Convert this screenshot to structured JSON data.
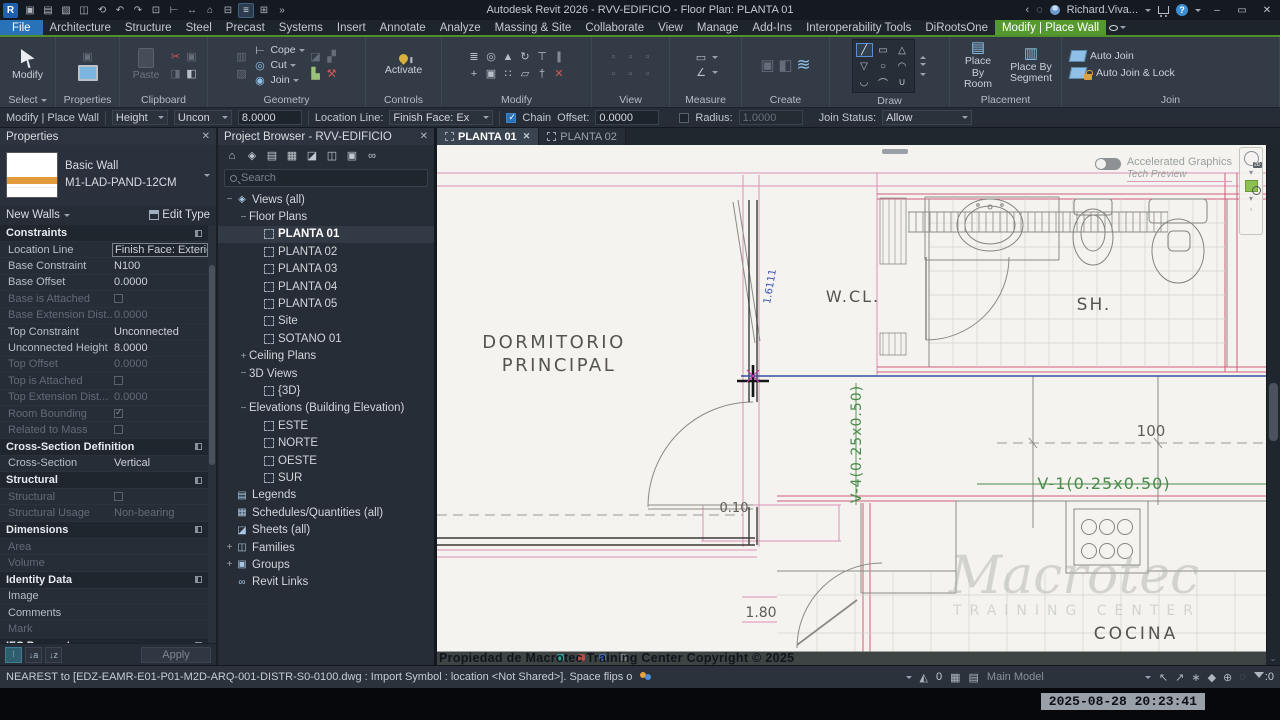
{
  "colors": {
    "contextual_green": "#55982e",
    "file_blue": "#2a72b8",
    "selection_blue": "#3450a0",
    "underlay_pink": "#dd8fb4",
    "underlay_red": "#cf5d78",
    "beam_green": "#4a8a4a",
    "canvas_bg": "#f4f3ef"
  },
  "title_bar": {
    "window_title": "Autodesk Revit 2026 - RVV-EDIFICIO - Floor Plan: PLANTA 01",
    "logo": "R",
    "user": "Richard.Viva...",
    "quick_access_icons": [
      "app-home",
      "new",
      "open",
      "save",
      "sync",
      "undo",
      "redo",
      "print",
      "measure",
      "dimension",
      "home-3d",
      "section",
      "thin-lines",
      "interface",
      "more"
    ],
    "right_icons": [
      "prev-arrow",
      "search",
      "avatar",
      "cart",
      "help"
    ],
    "window_controls": [
      "minimize",
      "restore",
      "close"
    ]
  },
  "ribbon": {
    "tabs": [
      {
        "label": "File",
        "style": "file"
      },
      {
        "label": "Architecture"
      },
      {
        "label": "Structure"
      },
      {
        "label": "Steel"
      },
      {
        "label": "Precast"
      },
      {
        "label": "Systems"
      },
      {
        "label": "Insert"
      },
      {
        "label": "Annotate"
      },
      {
        "label": "Analyze"
      },
      {
        "label": "Massing & Site"
      },
      {
        "label": "Collaborate"
      },
      {
        "label": "View"
      },
      {
        "label": "Manage"
      },
      {
        "label": "Add-Ins"
      },
      {
        "label": "Interoperability Tools"
      },
      {
        "label": "DiRootsOne"
      },
      {
        "label": "Modify | Place Wall",
        "style": "ctx"
      }
    ],
    "panels": {
      "select": {
        "label": "Select",
        "button": "Modify"
      },
      "properties": {
        "label": "Properties"
      },
      "clipboard": {
        "label": "Clipboard",
        "paste": "Paste",
        "icons": [
          "cut",
          "copy",
          "match"
        ]
      },
      "geometry": {
        "label": "Geometry",
        "items": [
          "Cope",
          "Cut",
          "Join"
        ]
      },
      "controls": {
        "label": "Controls",
        "button": "Activate"
      },
      "modify": {
        "label": "Modify",
        "icons": [
          "align",
          "offset",
          "mirror",
          "rotate",
          "trim",
          "split",
          "move",
          "copy",
          "array",
          "scale",
          "pin",
          "delete"
        ]
      },
      "view": {
        "label": "View",
        "icons": [
          "view-icon-1",
          "view-icon-2",
          "view-icon-3",
          "view-icon-4",
          "view-icon-5",
          "view-icon-6"
        ]
      },
      "measure": {
        "label": "Measure",
        "icons": [
          "ruler",
          "angular"
        ]
      },
      "create": {
        "label": "Create",
        "icons": [
          "group",
          "assembly",
          "wall"
        ]
      },
      "draw": {
        "label": "Draw",
        "tools": [
          "line",
          "rectangle",
          "inscribed-polygon",
          "circumscribed-polygon",
          "circle",
          "arc-start-end",
          "arc-center-ends",
          "arc-tangent",
          "arc-fillet"
        ]
      },
      "placement": {
        "label": "Placement",
        "buttons": [
          "Place By\nRoom",
          "Place By\nSegment"
        ]
      },
      "join": {
        "label": "Join",
        "items": [
          "Auto Join",
          "Auto Join & Lock"
        ]
      }
    }
  },
  "options_bar": {
    "mode_label": "Modify | Place Wall",
    "height_dd": "Height",
    "level_dd": "Uncon",
    "height_value": "8.0000",
    "location_line_label": "Location Line:",
    "location_line_value": "Finish Face: Ex",
    "chain_label": "Chain",
    "chain_checked": true,
    "offset_label": "Offset:",
    "offset_value": "0.0000",
    "radius_label": "Radius:",
    "radius_value": "1.0000",
    "radius_checked": false,
    "join_status_label": "Join Status:",
    "join_status_value": "Allow"
  },
  "properties": {
    "header": "Properties",
    "type_family": "Basic Wall",
    "type_name": "M1-LAD-PAND-12CM",
    "selector": "New Walls",
    "edit_type": "Edit Type",
    "apply": "Apply",
    "sections": [
      {
        "title": "Constraints",
        "rows": [
          {
            "label": "Location Line",
            "value": "Finish Face: Exterior",
            "boxed": true
          },
          {
            "label": "Base Constraint",
            "value": "N100"
          },
          {
            "label": "Base Offset",
            "value": "0.0000"
          },
          {
            "label": "Base is Attached",
            "checkbox": true,
            "checked": false,
            "disabled": true
          },
          {
            "label": "Base Extension Dist...",
            "value": "0.0000",
            "disabled": true
          },
          {
            "label": "Top Constraint",
            "value": "Unconnected"
          },
          {
            "label": "Unconnected Height",
            "value": "8.0000"
          },
          {
            "label": "Top Offset",
            "value": "0.0000",
            "disabled": true
          },
          {
            "label": "Top is Attached",
            "checkbox": true,
            "checked": false,
            "disabled": true
          },
          {
            "label": "Top Extension Dist...",
            "value": "0.0000",
            "disabled": true
          },
          {
            "label": "Room Bounding",
            "checkbox": true,
            "checked": true,
            "disabled": true
          },
          {
            "label": "Related to Mass",
            "checkbox": true,
            "checked": false,
            "disabled": true
          }
        ]
      },
      {
        "title": "Cross-Section Definition",
        "rows": [
          {
            "label": "Cross-Section",
            "value": "Vertical"
          }
        ]
      },
      {
        "title": "Structural",
        "rows": [
          {
            "label": "Structural",
            "checkbox": true,
            "checked": false,
            "disabled": true
          },
          {
            "label": "Structural Usage",
            "value": "Non-bearing",
            "disabled": true
          }
        ]
      },
      {
        "title": "Dimensions",
        "rows": [
          {
            "label": "Area",
            "value": "",
            "disabled": true
          },
          {
            "label": "Volume",
            "value": "",
            "disabled": true
          }
        ]
      },
      {
        "title": "Identity Data",
        "rows": [
          {
            "label": "Image",
            "value": ""
          },
          {
            "label": "Comments",
            "value": ""
          },
          {
            "label": "Mark",
            "value": "",
            "disabled": true
          }
        ]
      },
      {
        "title": "IFC Parameters",
        "rows": []
      }
    ]
  },
  "project_browser": {
    "header": "Project Browser - RVV-EDIFICIO",
    "search_placeholder": "Search",
    "toolbar_icons": [
      "home",
      "views",
      "legends",
      "schedules",
      "sheets",
      "families",
      "groups",
      "links"
    ],
    "tree": [
      {
        "label": "Views (all)",
        "level": 0,
        "exp": "minus",
        "icon": "views"
      },
      {
        "label": "Floor Plans",
        "level": 1,
        "exp": "minus"
      },
      {
        "label": "PLANTA 01",
        "level": 2,
        "icon": "plan",
        "bold": true
      },
      {
        "label": "PLANTA 02",
        "level": 2,
        "icon": "plan"
      },
      {
        "label": "PLANTA 03",
        "level": 2,
        "icon": "plan"
      },
      {
        "label": "PLANTA 04",
        "level": 2,
        "icon": "plan"
      },
      {
        "label": "PLANTA 05",
        "level": 2,
        "icon": "plan"
      },
      {
        "label": "Site",
        "level": 2,
        "icon": "plan"
      },
      {
        "label": "SOTANO 01",
        "level": 2,
        "icon": "plan"
      },
      {
        "label": "Ceiling Plans",
        "level": 1,
        "exp": "plus"
      },
      {
        "label": "3D Views",
        "level": 1,
        "exp": "minus"
      },
      {
        "label": "{3D}",
        "level": 2,
        "icon": "plan"
      },
      {
        "label": "Elevations (Building Elevation)",
        "level": 1,
        "exp": "minus"
      },
      {
        "label": "ESTE",
        "level": 2,
        "icon": "plan"
      },
      {
        "label": "NORTE",
        "level": 2,
        "icon": "plan"
      },
      {
        "label": "OESTE",
        "level": 2,
        "icon": "plan"
      },
      {
        "label": "SUR",
        "level": 2,
        "icon": "plan"
      },
      {
        "label": "Legends",
        "level": 0,
        "icon": "legends"
      },
      {
        "label": "Schedules/Quantities (all)",
        "level": 0,
        "icon": "schedules"
      },
      {
        "label": "Sheets (all)",
        "level": 0,
        "icon": "sheets"
      },
      {
        "label": "Families",
        "level": 0,
        "exp": "plus",
        "icon": "families"
      },
      {
        "label": "Groups",
        "level": 0,
        "exp": "plus",
        "icon": "groups"
      },
      {
        "label": "Revit Links",
        "level": 0,
        "icon": "links"
      }
    ]
  },
  "canvas": {
    "tabs": [
      {
        "label": "PLANTA 01",
        "active": true
      },
      {
        "label": "PLANTA 02",
        "active": false
      }
    ],
    "toggle": {
      "line1": "Accelerated Graphics",
      "line2": "Tech Preview"
    },
    "nav_badge": "2D",
    "labels": {
      "room1a": "DORMITORIO",
      "room1b": "PRINCIPAL",
      "wcl": "W.CL.",
      "sh": "SH.",
      "cocina": "COCINA",
      "dim100": "100",
      "dim010": "0.10",
      "dim180": "1.80",
      "dim16111": "1.6111",
      "beam_v1": "V-1(0.25x0.50)",
      "beam_v4": "V-4(0.25x0.50)",
      "watermark1": "Macrotec",
      "watermark2": "TRAINING CENTER",
      "copyright": "Propiedad de Macrotec Training Center Copyright © 2025"
    }
  },
  "status_bar": {
    "prompt": "NEAREST  to [EDZ-EAMR-E01-P01-M2D-ARQ-001-DISTR-S0-0100.dwg : Import Symbol : location <Not Shared>].  Space flips o",
    "owned_count": "0",
    "main_model": "Main Model",
    "filter_count": ":0",
    "icons": [
      "select-links",
      "select-underlay",
      "select-pinned",
      "select-faces",
      "drag-on-selection",
      "reveal-constraints"
    ],
    "timestamp": "2025-08-28 20:23:41"
  }
}
